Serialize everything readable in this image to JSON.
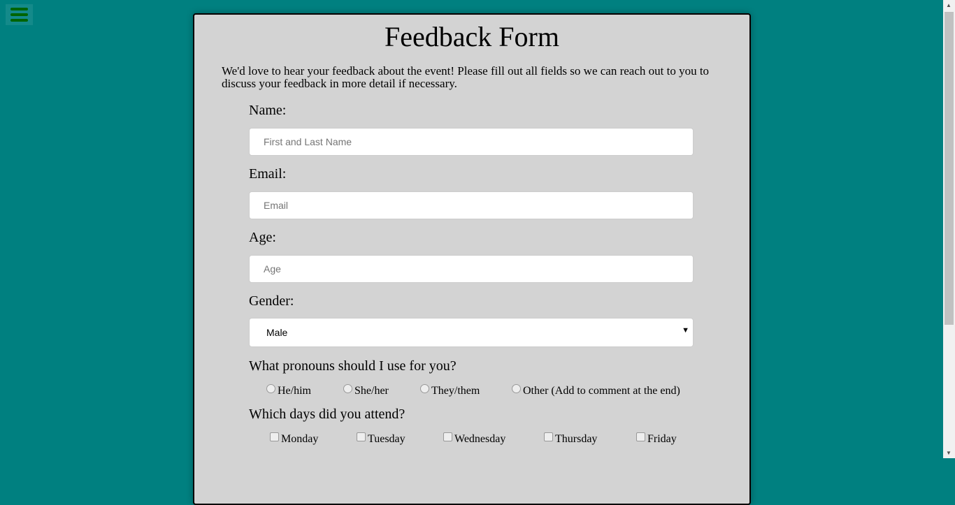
{
  "title": "Feedback Form",
  "intro": "We'd love to hear your feedback about the event! Please fill out all fields so we can reach out to you to discuss your feedback in more detail if necessary.",
  "name": {
    "label": "Name:",
    "placeholder": "First and Last Name",
    "value": ""
  },
  "email": {
    "label": "Email:",
    "placeholder": "Email",
    "value": ""
  },
  "age": {
    "label": "Age:",
    "placeholder": "Age",
    "value": ""
  },
  "gender": {
    "label": "Gender:",
    "selected": "Male"
  },
  "pronouns": {
    "label": "What pronouns should I use for you?",
    "options": [
      "He/him",
      "She/her",
      "They/them",
      "Other (Add to comment at the end)"
    ]
  },
  "days": {
    "label": "Which days did you attend?",
    "options": [
      "Monday",
      "Tuesday",
      "Wednesday",
      "Thursday",
      "Friday"
    ]
  },
  "colors": {
    "background": "#008080",
    "card": "#d3d3d3",
    "menu": "#006400"
  }
}
